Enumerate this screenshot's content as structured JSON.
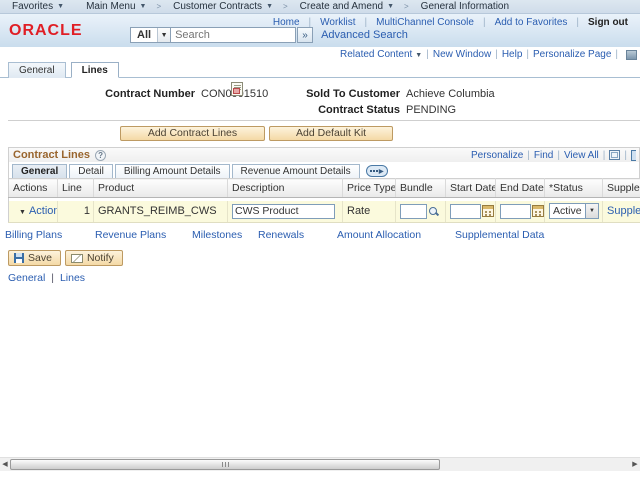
{
  "breadcrumb": {
    "items": [
      "Favorites",
      "Main Menu",
      "Customer Contracts",
      "Create and Amend",
      "General Information"
    ]
  },
  "header": {
    "brand": "ORACLE",
    "nav_links": [
      "Home",
      "Worklist",
      "MultiChannel Console",
      "Add to Favorites"
    ],
    "sign_out": "Sign out",
    "search_scope": "All",
    "search_placeholder": "Search",
    "go_glyph": "»",
    "advanced_search": "Advanced Search"
  },
  "page_toolbar": {
    "links": [
      "Related Content",
      "New Window",
      "Help",
      "Personalize Page"
    ]
  },
  "page_tabs": [
    "General",
    "Lines"
  ],
  "contract": {
    "number_label": "Contract Number",
    "number": "CON0001510",
    "sold_to_label": "Sold To Customer",
    "sold_to": "Achieve Columbia",
    "status_label": "Contract Status",
    "status": "PENDING"
  },
  "action_buttons": {
    "add_contract_lines": "Add Contract Lines",
    "add_default_kit": "Add Default Kit"
  },
  "grid": {
    "title": "Contract Lines",
    "toolbar_links": [
      "Personalize",
      "Find",
      "View All"
    ],
    "tabs": [
      "General",
      "Detail",
      "Billing Amount Details",
      "Revenue Amount Details"
    ],
    "columns": [
      "Actions",
      "Line",
      "Product",
      "Description",
      "Price Type",
      "Bundle",
      "Start Date",
      "End Date",
      "*Status",
      "Suppleme"
    ],
    "row": {
      "actions_label": "Actions",
      "line": "1",
      "product": "GRANTS_REIMB_CWS",
      "description": "CWS Product",
      "price_type": "Rate",
      "bundle": "",
      "start_date": "",
      "end_date": "",
      "status": "Active",
      "supplemental_link": "Suppleme"
    }
  },
  "related_links": [
    "Billing Plans",
    "Revenue Plans",
    "Milestones",
    "Renewals",
    "Amount Allocation",
    "Supplemental Data"
  ],
  "footer": {
    "save": "Save",
    "notify": "Notify",
    "links": [
      "General",
      "Lines"
    ]
  },
  "colors": {
    "brand_red": "#e01e25",
    "link_blue": "#2a5db0",
    "group_title_brown": "#99652e",
    "row_yellow": "#fbfadd",
    "button_tan": "#f4d9a6"
  }
}
